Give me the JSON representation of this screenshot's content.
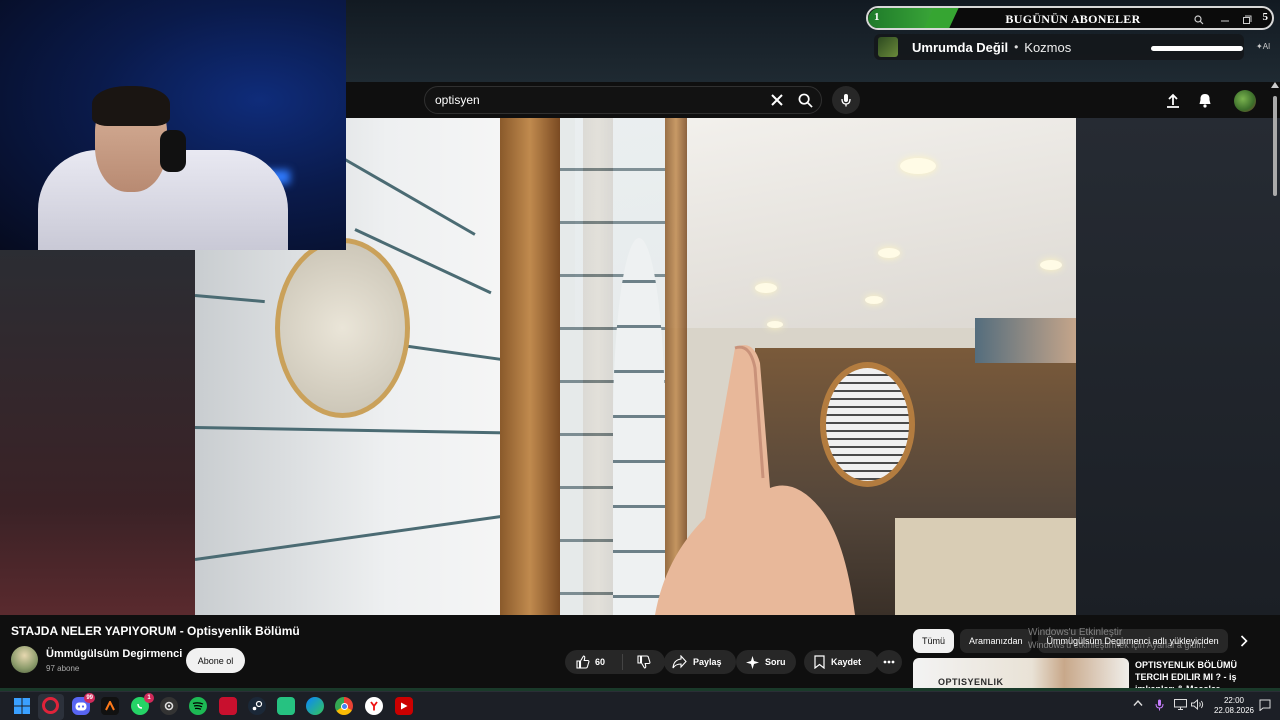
{
  "music_overlay": {
    "subscriber_start": "1",
    "subscriber_title": "BUGÜNÜN ABONELER",
    "subscriber_goal": "5",
    "song": "Umrumda Değil",
    "separator": "•",
    "artist": "Kozmos",
    "badge": "AI"
  },
  "youtube": {
    "search_value": "optisyen",
    "video_title": "STAJDA NELER YAPIYORUM - Optisyenlik Bölümü",
    "channel_name": "Ümmügülsüm Degirmenci",
    "channel_subs": "97 abone",
    "subscribe_label": "Abone ol",
    "like_count": "60",
    "share_label": "Paylaş",
    "ask_label": "Soru",
    "save_label": "Kaydet",
    "chips": [
      "Tümü",
      "Aramanızdan",
      "Ümmügülsüm Degirmenci adlı yükleyiciden"
    ],
    "rec_thumb_text": "OPTISYENLIK",
    "rec_title": "OPTISYENLIK BÖLÜMÜ TERCIH EDILIR MI ? - iş imkanları & Maaşlar"
  },
  "windows_watermark": {
    "line1": "Windows'u Etkinleştir",
    "line2": "Windows'u etkinleştirmek için Ayarlar'a gidin."
  },
  "taskbar": {
    "discord_badge": "99",
    "whatsapp_badge": "1",
    "time": "22:00",
    "date": "22.08.2026"
  },
  "colors": {
    "youtube_bg": "#0f0f0f",
    "subscriber_fill": "#3fae3b",
    "youtube_red": "#ff0000"
  }
}
